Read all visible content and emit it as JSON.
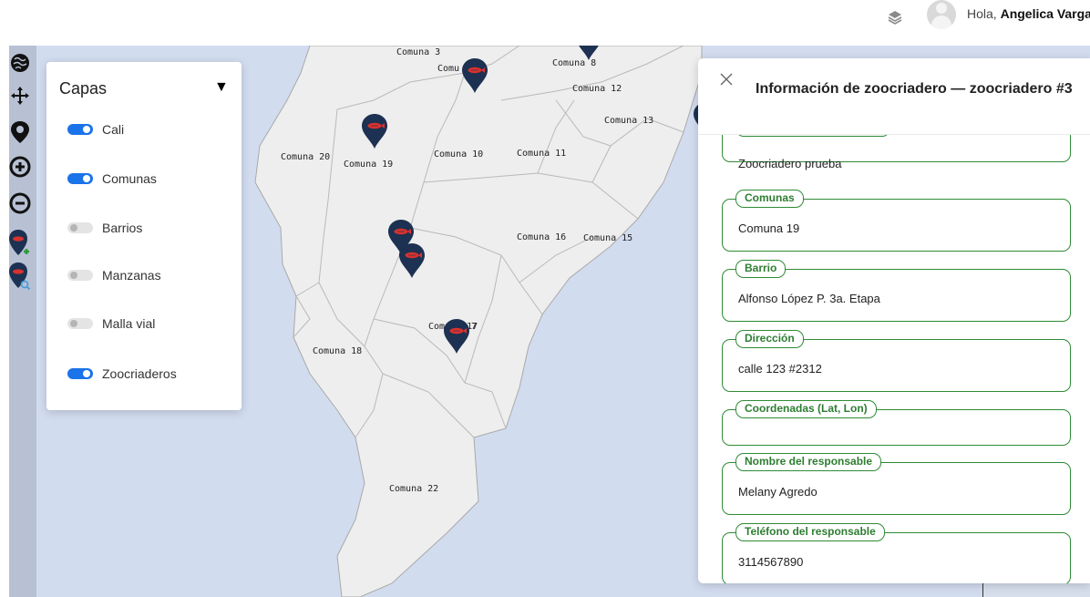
{
  "header": {
    "greeting_prefix": "Hola, ",
    "user_name": "Angelica Varga",
    "layers_icon": "layers-icon",
    "avatar_icon": "user-avatar-icon"
  },
  "toolbar": {
    "tools": [
      {
        "name": "map-layers-icon"
      },
      {
        "name": "pan-move-icon"
      },
      {
        "name": "location-pin-icon"
      },
      {
        "name": "zoom-in-icon"
      },
      {
        "name": "zoom-out-icon"
      },
      {
        "name": "add-zoocriadero-icon"
      },
      {
        "name": "search-zoocriadero-icon"
      }
    ]
  },
  "layers_panel": {
    "title": "Capas",
    "arrow": "▼",
    "layers": [
      {
        "label": "Cali",
        "enabled": true
      },
      {
        "label": "Comunas",
        "enabled": true
      },
      {
        "label": "Barrios",
        "enabled": false
      },
      {
        "label": "Manzanas",
        "enabled": false
      },
      {
        "label": "Malla vial",
        "enabled": false
      },
      {
        "label": "Zoocriaderos",
        "enabled": true
      }
    ]
  },
  "map": {
    "comuna_labels": [
      "Comuna 3",
      "Comuna 8",
      "Comuna 12",
      "Comuna 13",
      "Comuna 20",
      "Comuna 19",
      "Comuna 10",
      "Comuna 11",
      "Comuna 16",
      "Comuna 15",
      "Comuna 17",
      "Comuna 18",
      "Comuna 22",
      "Comu"
    ],
    "colors": {
      "water": "#d2dcef",
      "land": "#eeeeee",
      "border": "#b5b5b5",
      "marker": "#1d3152",
      "fish": "#d9322e"
    }
  },
  "info_panel": {
    "close_icon": "close-icon",
    "title": "Información de zoocriadero — zoocriadero #3",
    "fields": [
      {
        "label": "",
        "value": "Zoocriadero prueba"
      },
      {
        "label": "Comunas",
        "value": "Comuna 19"
      },
      {
        "label": "Barrio",
        "value": "Alfonso López P. 3a. Etapa"
      },
      {
        "label": "Dirección",
        "value": "calle 123 #2312"
      },
      {
        "label": "Coordenadas (Lat, Lon)",
        "value": ""
      },
      {
        "label": "Nombre del responsable",
        "value": "Melany Agredo"
      },
      {
        "label": "Teléfono del responsable",
        "value": "3114567890"
      }
    ],
    "accent_color": "#2e8b35"
  }
}
